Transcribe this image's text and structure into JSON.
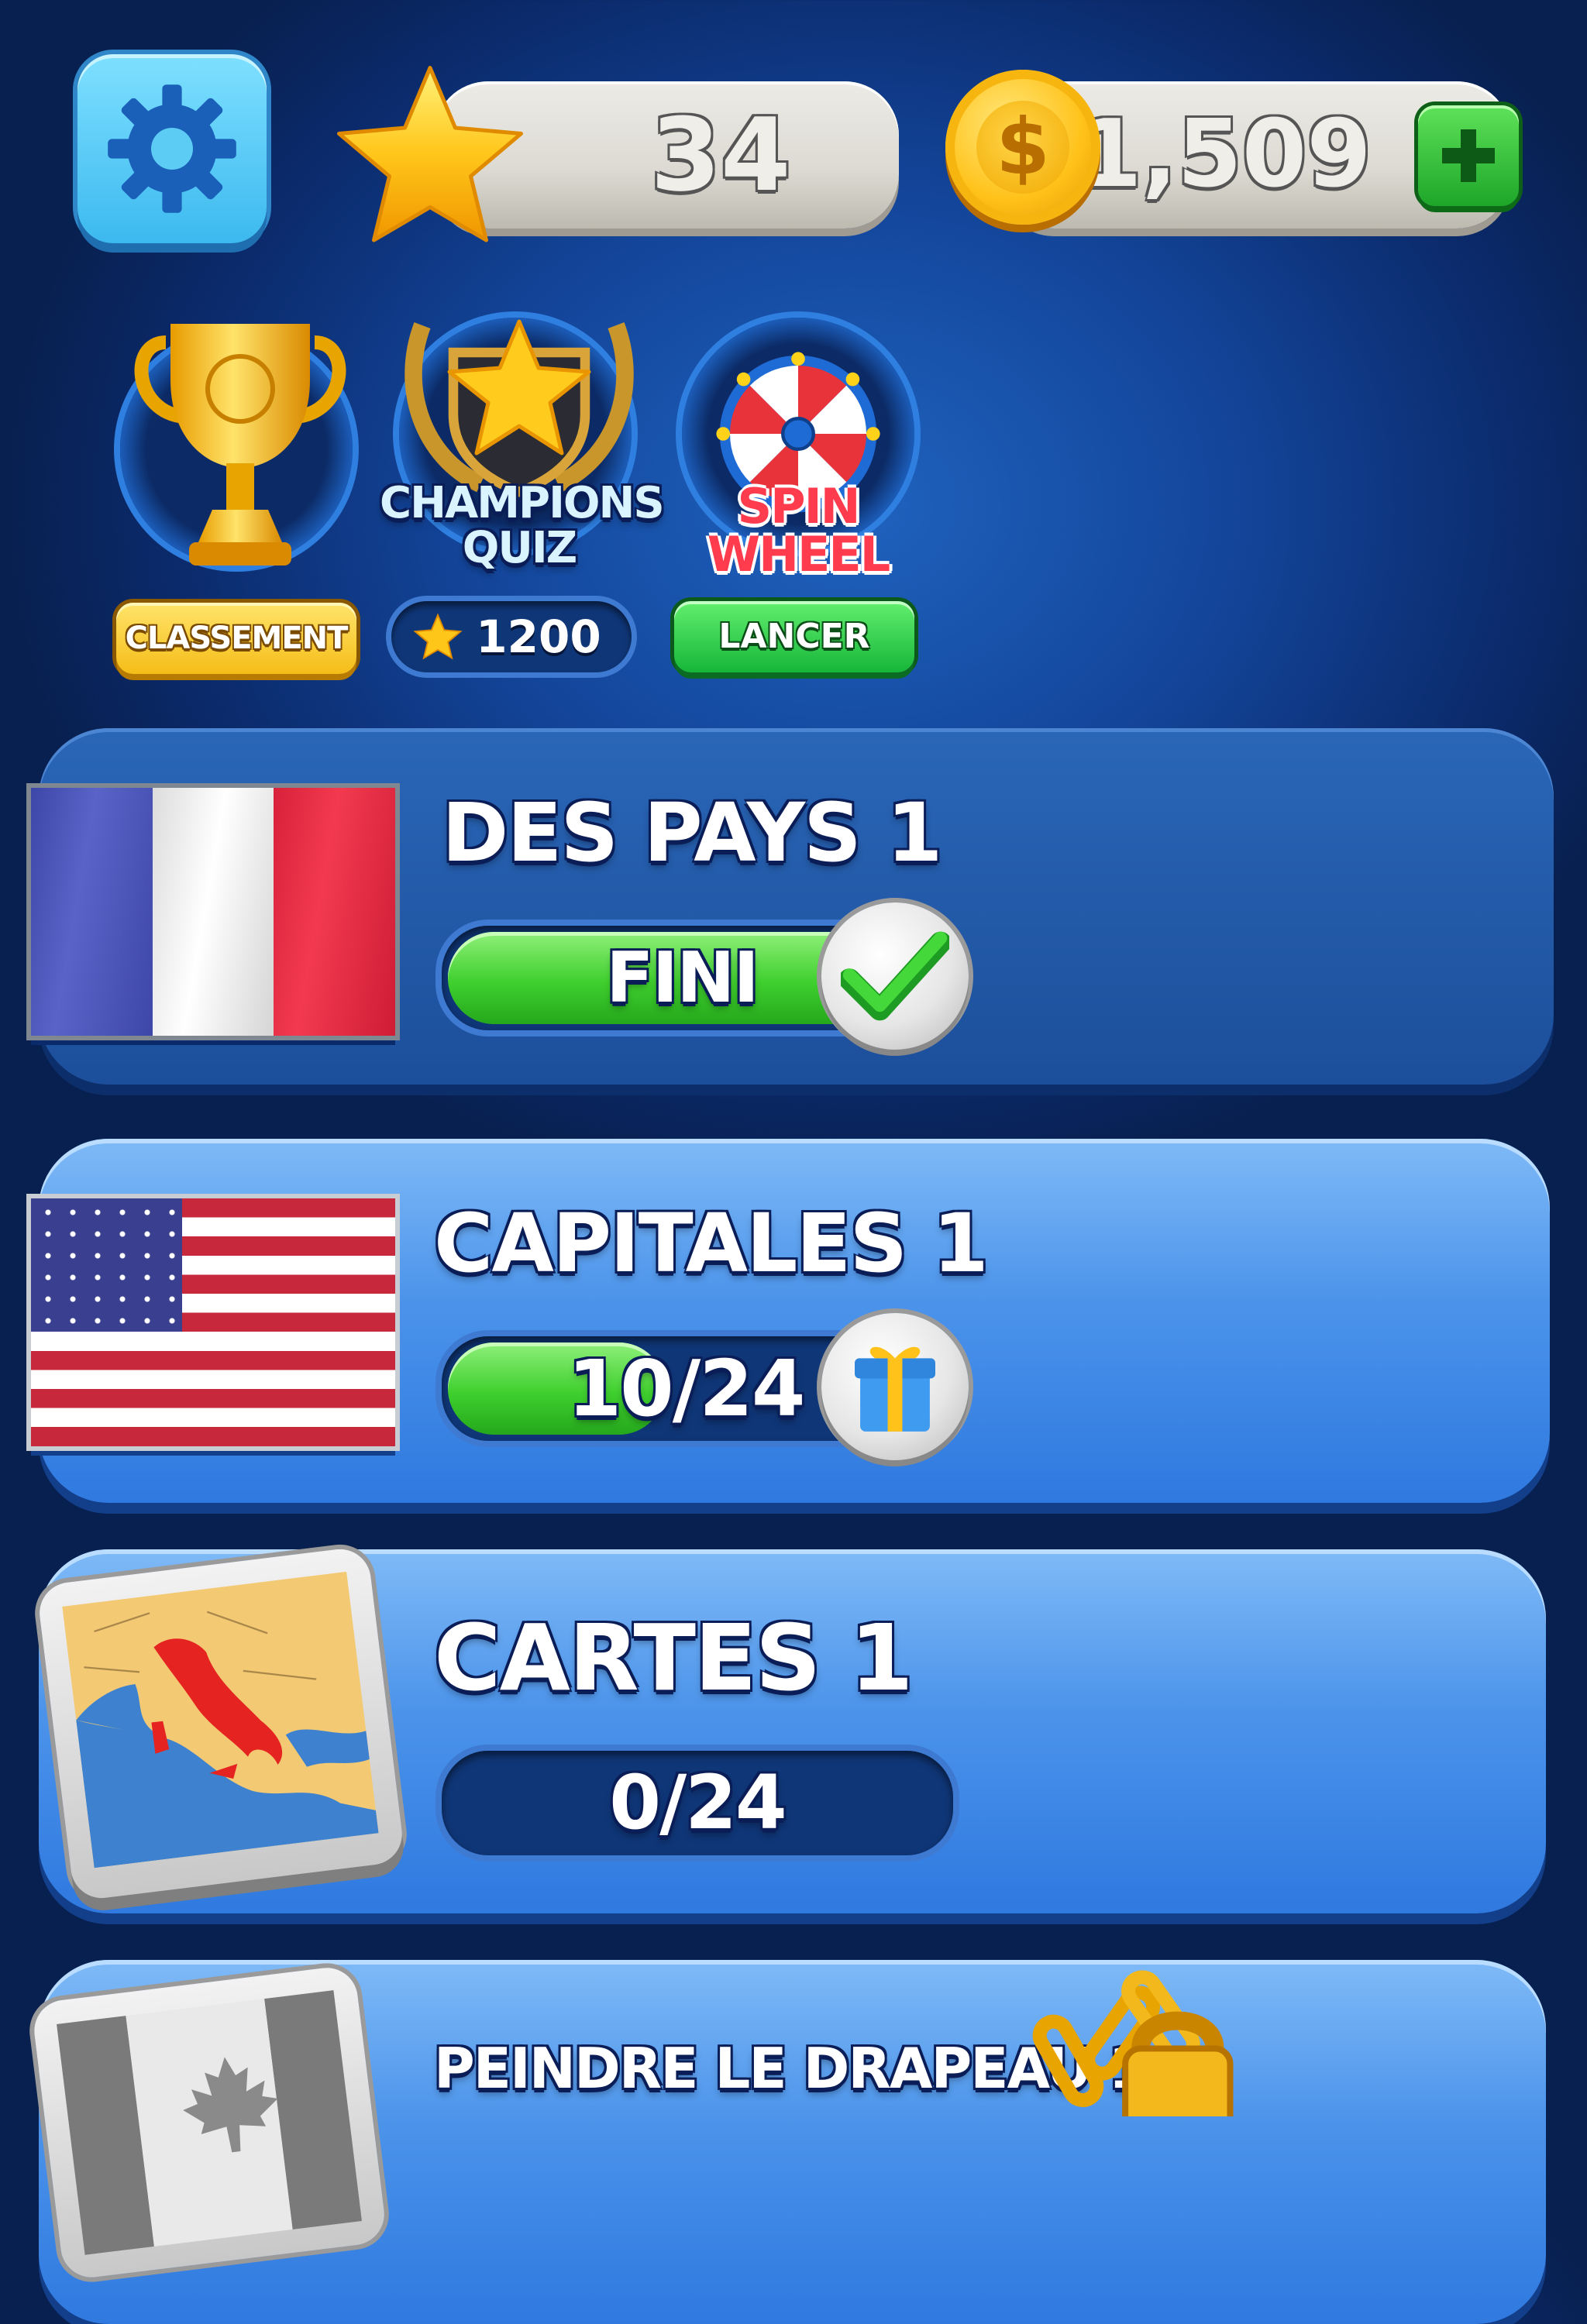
{
  "header": {
    "settings_icon": "gear-icon",
    "stars": "34",
    "star_icon": "star-icon",
    "coins": "1,509",
    "coin_icon": "coin-icon",
    "add_icon": "plus-icon"
  },
  "features": {
    "leaderboard": {
      "icon": "trophy-icon",
      "button_label": "CLASSEMENT"
    },
    "champions_quiz": {
      "title_line1": "CHAMPIONS",
      "title_line2": "QUIZ",
      "cost": "1200",
      "icon": "star-shield-icon"
    },
    "spin_wheel": {
      "title_line1": "SPIN",
      "title_line2": "WHEEL",
      "button_label": "LANCER",
      "icon": "wheel-icon"
    }
  },
  "levels": [
    {
      "title": "DES PAYS 1",
      "progress_label": "FINI",
      "progress_fraction": 1.0,
      "status_icon": "checkmark-icon",
      "image": "france-flag"
    },
    {
      "title": "CAPITALES 1",
      "progress_label": "10/24",
      "progress_fraction": 0.4167,
      "status_icon": "gift-icon",
      "image": "usa-flag"
    },
    {
      "title": "CARTES 1",
      "progress_label": "0/24",
      "progress_fraction": 0,
      "image": "italy-map"
    },
    {
      "title": "PEINDRE LE DRAPEAU 1",
      "image": "canada-flag-grey",
      "status_icon": "padlock-icon"
    }
  ],
  "colors": {
    "accent_green": "#3fcf2e",
    "gold": "#ffcc1e",
    "background": "#13459a"
  }
}
